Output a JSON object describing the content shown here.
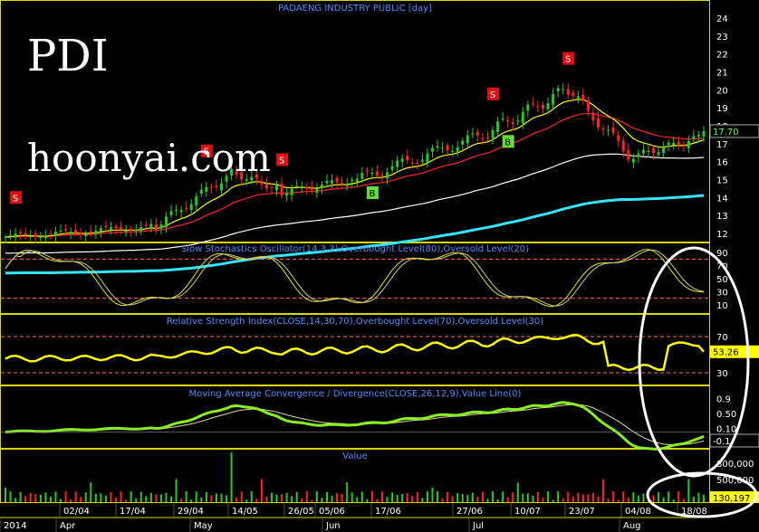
{
  "chart_title": "PADAENG INDUSTRY PUBLIC [day]",
  "watermark": {
    "ticker": "PDI",
    "site": "hoonyai.com"
  },
  "colors": {
    "bg": "#000000",
    "panel_border": "#d6d600",
    "title_text": "#4a8cff",
    "ema_yellow": "#ffff00",
    "ema_red": "#ff2222",
    "ema_white": "#ffffff",
    "ema_cyan": "#33e6ff",
    "bull": "#22cc22",
    "bear": "#ff2222",
    "stoch": "#e6e600",
    "rsi": "#ffff00",
    "macd": "#88ee22",
    "signal": "#dddddd"
  },
  "price_panel": {
    "y_ticks": [
      "24",
      "23",
      "22",
      "21",
      "20",
      "19",
      "18",
      "17",
      "16",
      "15",
      "14",
      "13",
      "12"
    ],
    "last_price": "17.70",
    "signals": [
      {
        "type": "S",
        "x_index": 2
      },
      {
        "type": "S",
        "x_index": 40
      },
      {
        "type": "S",
        "x_index": 55
      },
      {
        "type": "B",
        "x_index": 74
      },
      {
        "type": "S",
        "x_index": 98
      },
      {
        "type": "B",
        "x_index": 101
      },
      {
        "type": "S",
        "x_index": 113
      }
    ]
  },
  "stoch_panel": {
    "title": "Slow Stochastics Oscillator(14,3,3),Overbought Level(80),Oversold Level(20)",
    "y_ticks": [
      "90",
      "70",
      "50",
      "30",
      "10"
    ]
  },
  "rsi_panel": {
    "title": "Relative Strength Index(CLOSE,14,30,70),Overbought Level(70),Oversold Level(30)",
    "y_ticks": [
      "70",
      "50",
      "30"
    ],
    "last_value": "53.26"
  },
  "macd_panel": {
    "title": "Moving Average Convergence / Divergence(CLOSE,26,12,9),Value Line(0)",
    "y_ticks": [
      "0.9",
      "0.50",
      "0.10",
      "0.10"
    ],
    "last_value": "-0.1"
  },
  "volume_panel": {
    "title": "Value",
    "y_ticks": [
      "800,000",
      "500,000"
    ],
    "last_value": "130,197"
  },
  "x_axis": {
    "dates": [
      "02/04",
      "17/04",
      "29/04",
      "14/05",
      "26/05",
      "05/06",
      "17/06",
      "27/06",
      "10/07",
      "23/07",
      "04/08",
      "18/08"
    ],
    "months": [
      "2014",
      "Apr",
      "May",
      "Jun",
      "Jul",
      "Aug"
    ]
  },
  "chart_data": {
    "type": "line",
    "title": "PADAENG INDUSTRY PUBLIC [day]",
    "x": [
      "02/04",
      "17/04",
      "29/04",
      "14/05",
      "26/05",
      "05/06",
      "17/06",
      "27/06",
      "10/07",
      "23/07",
      "04/08",
      "18/08"
    ],
    "series": [
      {
        "name": "price_close",
        "values": [
          11.8,
          12.1,
          12.8,
          13.6,
          14.4,
          14.6,
          15.6,
          17.0,
          17.5,
          20.0,
          16.8,
          17.7
        ]
      },
      {
        "name": "RSI",
        "values": [
          53,
          55,
          52,
          56,
          57,
          55,
          65,
          72,
          70,
          78,
          36,
          53.26
        ]
      }
    ],
    "ylim": [
      11.5,
      24.5
    ]
  }
}
